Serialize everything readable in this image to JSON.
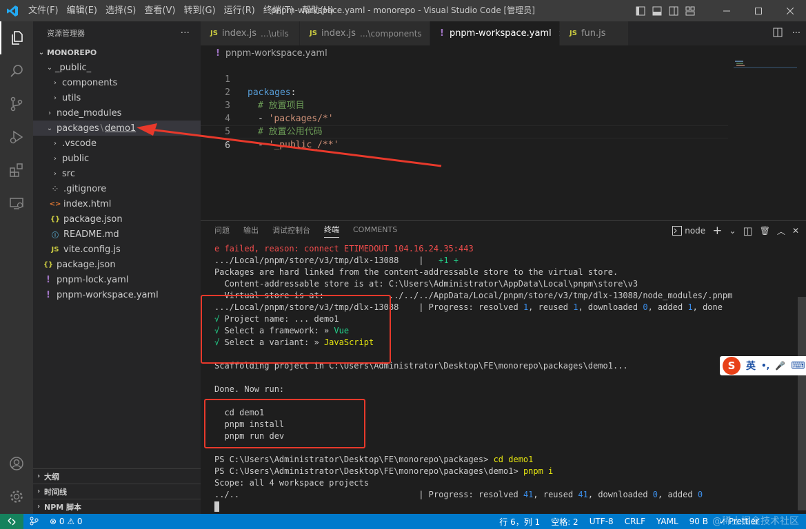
{
  "titlebar": {
    "menu": [
      "文件(F)",
      "编辑(E)",
      "选择(S)",
      "查看(V)",
      "转到(G)",
      "运行(R)",
      "终端(T)",
      "帮助(H)"
    ],
    "title": "pnpm-workspace.yaml - monorepo - Visual Studio Code [管理员]"
  },
  "sidebar": {
    "title": "资源管理器",
    "more": "···",
    "tree": [
      {
        "twisty": "⌄",
        "label": "MONOREPO"
      },
      {
        "twisty": "⌄",
        "label": "_public_"
      },
      {
        "twisty": "›",
        "label": "components"
      },
      {
        "twisty": "›",
        "label": "utils"
      },
      {
        "twisty": "›",
        "label": "node_modules"
      },
      {
        "twisty": "⌄",
        "label": "packages",
        "sub": "demo1"
      },
      {
        "twisty": "›",
        "label": ".vscode"
      },
      {
        "twisty": "›",
        "label": "public"
      },
      {
        "twisty": "›",
        "label": "src"
      },
      {
        "icon": "⁘",
        "label": ".gitignore"
      },
      {
        "icon": "<>",
        "label": "index.html"
      },
      {
        "icon": "{}",
        "label": "package.json"
      },
      {
        "icon": "ⓘ",
        "label": "README.md"
      },
      {
        "icon": "JS",
        "label": "vite.config.js"
      },
      {
        "icon": "{}",
        "label": "package.json"
      },
      {
        "icon": "!",
        "label": "pnpm-lock.yaml"
      },
      {
        "icon": "!",
        "label": "pnpm-workspace.yaml"
      }
    ],
    "sections": [
      "大纲",
      "时间线",
      "NPM 脚本"
    ]
  },
  "tabs": [
    {
      "name": "index.js",
      "hint": "...\\utils"
    },
    {
      "name": "index.js",
      "hint": "...\\components"
    },
    {
      "name": "pnpm-workspace.yaml",
      "close": "×"
    },
    {
      "name": "fun.js"
    }
  ],
  "tab_icons": {
    "js": "JS",
    "yaml": "!"
  },
  "editor": {
    "breadcrumb": "pnpm-workspace.yaml",
    "line_numbers": [
      "1",
      "2",
      "3",
      "4",
      "5",
      "6"
    ],
    "l1_key": "packages",
    "colon": ":",
    "l2": "# 放置项目",
    "dash": "- ",
    "l3": "'packages/*'",
    "l4": "# 放置公用代码",
    "l5": "'_public_/**'"
  },
  "panel": {
    "tabs": [
      "问题",
      "输出",
      "调试控制台",
      "终端",
      "COMMENTS"
    ],
    "shell": "node",
    "actions": {
      "add": "+",
      "chev": "⌄",
      "split": "◫",
      "trash": "🗑",
      "max": "︿",
      "close": "✕"
    }
  },
  "terminal": {
    "t1": "e failed, reason: connect ETIMEDOUT 104.16.24.35:443",
    "t2a": ".../Local/pnpm/store/v3/tmp/dlx-13088    |   ",
    "t2b": "+1 +",
    "t3": "Packages are hard linked from the content-addressable store to the virtual store.",
    "t4": "  Content-addressable store is at: C:\\Users\\Administrator\\AppData\\Local\\pnpm\\store\\v3",
    "t5": "  Virtual store is at:             ../../../AppData/Local/pnpm/store/v3/tmp/dlx-13088/node_modules/.pnpm",
    "t6a": ".../Local/pnpm/store/v3/tmp/dlx-13088    | Progress: resolved ",
    "t6n1": "1",
    "t6b": ", reused ",
    "t6n2": "1",
    "t6c": ", downloaded ",
    "t6n3": "0",
    "t6d": ", added ",
    "t6n4": "1",
    "t6e": ", done",
    "check": "√",
    "t7": " Project name: ... demo1",
    "t8": " Select a framework: » ",
    "t8v": "Vue",
    "t9": " Select a variant: » ",
    "t9v": "JavaScript",
    "t10": "Scaffolding project in C:\\Users\\Administrator\\Desktop\\FE\\monorepo\\packages\\demo1...",
    "t11": "Done. Now run:",
    "t12": "  cd demo1",
    "t13": "  pnpm install",
    "t14": "  pnpm run dev",
    "t15": "PS C:\\Users\\Administrator\\Desktop\\FE\\monorepo\\packages> ",
    "t15c": "cd demo1",
    "t16": "PS C:\\Users\\Administrator\\Desktop\\FE\\monorepo\\packages\\demo1> ",
    "t16c": "pnpm i",
    "t17": "Scope: all 4 workspace projects",
    "t18a": "../..                                    | Progress: resolved ",
    "t18n1": "41",
    "t18b": ", reused ",
    "t18n2": "41",
    "t18c": ", downloaded ",
    "t18n3": "0",
    "t18d": ", added ",
    "t18n4": "0"
  },
  "ime": {
    "logo": "S",
    "lang": "英",
    "punct": "•,",
    "mic": "🎤",
    "kbd": "⌨"
  },
  "statusbar": {
    "errors": "⊗ 0 ⚠ 0",
    "position": "行 6，列 1",
    "spaces": "空格: 2",
    "encoding": "UTF-8",
    "eol": "CRLF",
    "language": "YAML",
    "size": "90 B",
    "formatter": "✓ Prettier",
    "watermark": "@稀土掘金技术社区"
  },
  "colors": {
    "accent": "#007acc",
    "annotation": "#e8392b",
    "remote": "#16825d"
  }
}
